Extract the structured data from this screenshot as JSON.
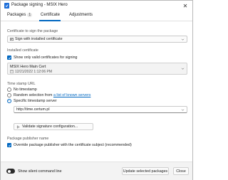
{
  "window": {
    "title": "Package signing - MSIX Hero"
  },
  "tabs": [
    {
      "label": "Packages",
      "badge": "1"
    },
    {
      "label": "Certificate"
    },
    {
      "label": "Adjustments"
    }
  ],
  "certificate": {
    "section_label": "Certificate to sign the package",
    "source_selected": "Sign with installed certificate",
    "installed_label": "Installed certificate",
    "show_valid_only": "Show only valid certificates for signing",
    "cert_name": "MSIX Hero Main Cert",
    "cert_date": "12/21/2022 1:12:06 PM"
  },
  "timestamp": {
    "section_label": "Time stamp URL",
    "options": [
      {
        "label": "No timestamp",
        "selected": false
      },
      {
        "label_prefix": "Random selection from ",
        "link": "a list of known servers",
        "selected": false
      },
      {
        "label": "Specific timestamp server",
        "selected": true
      }
    ],
    "url_value": "http://time.certum.pl"
  },
  "validate_button": "Validate signature configuration...",
  "publisher": {
    "section_label": "Package publisher name",
    "override_label": "Override package publisher with the certificate subject (recommended)"
  },
  "footer": {
    "silent_label": "Show silent command line",
    "update_button": "Update selected packages",
    "close_button": "Close"
  },
  "colors": {
    "accent": "#0067c0"
  }
}
